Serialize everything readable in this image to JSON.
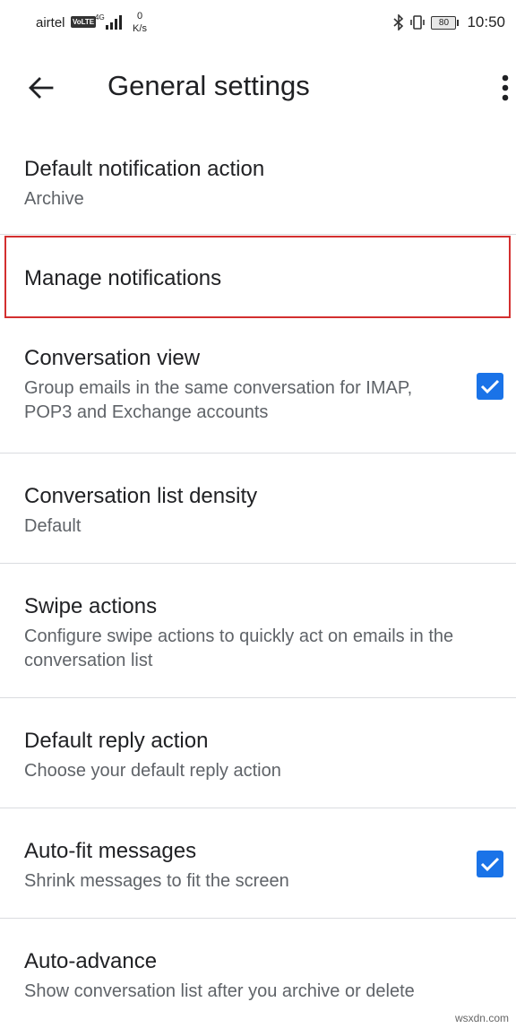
{
  "status_bar": {
    "carrier": "airtel",
    "volte": "VoLTE",
    "network": "4G",
    "speed_value": "0",
    "speed_unit": "K/s",
    "battery": "80",
    "time": "10:50"
  },
  "app_bar": {
    "title": "General settings",
    "back_icon": "arrow-back-icon",
    "menu_icon": "more-vert-icon"
  },
  "settings": [
    {
      "title": "Default notification action",
      "summary": "Archive"
    },
    {
      "title": "Manage notifications",
      "summary": ""
    },
    {
      "title": "Conversation view",
      "summary": "Group emails in the same conversation for IMAP, POP3 and Exchange accounts",
      "checked": true
    },
    {
      "title": "Conversation list density",
      "summary": "Default"
    },
    {
      "title": "Swipe actions",
      "summary": "Configure swipe actions to quickly act on emails in the conversation list"
    },
    {
      "title": "Default reply action",
      "summary": "Choose your default reply action"
    },
    {
      "title": "Auto-fit messages",
      "summary": "Shrink messages to fit the screen",
      "checked": true
    },
    {
      "title": "Auto-advance",
      "summary": "Show conversation list after you archive or delete"
    }
  ],
  "colors": {
    "accent": "#1a73e8",
    "highlight": "#d32f2f",
    "divider": "#dadce0"
  },
  "watermark": "wsxdn.com"
}
